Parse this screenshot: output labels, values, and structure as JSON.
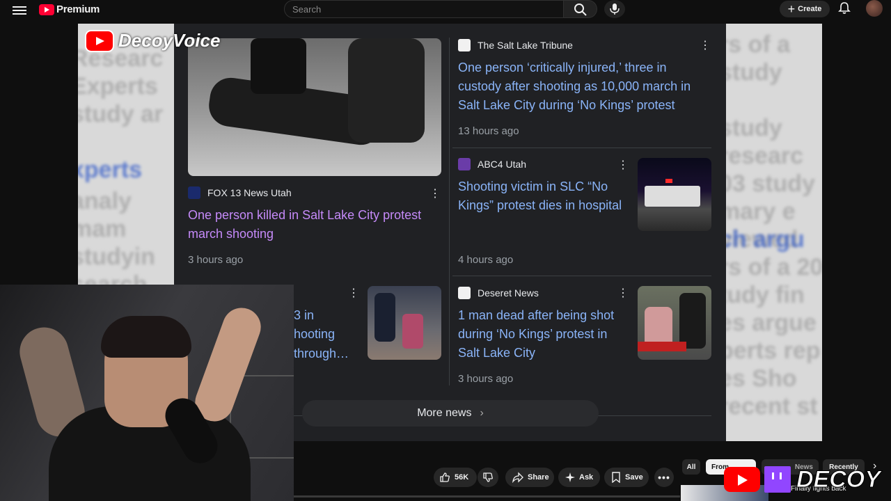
{
  "topbar": {
    "logo_text": "Premium",
    "search_placeholder": "Search",
    "create_label": "Create"
  },
  "video": {
    "channel_brand": "DecoyVoice",
    "news": {
      "articles": [
        {
          "source": "FOX 13 News Utah",
          "headline": "One person killed in Salt Lake City protest march shooting",
          "time": "3 hours ago"
        },
        {
          "source": "The Salt Lake Tribune",
          "headline": "One person ‘critically injured,’ three in custody after shooting as 10,000 march in Salt Lake City during ‘No Kings’ protest",
          "time": "13 hours ago"
        },
        {
          "source": "ABC4 Utah",
          "headline": "Shooting victim in SLC “No Kings” protest dies in hospital",
          "time": "4 hours ago"
        },
        {
          "source": "Deseret News",
          "headline": "1 man dead after being shot during ‘No Kings’ protest in Salt Lake City",
          "time": "3 hours ago"
        }
      ],
      "partial_headline_lines": [
        "3 in",
        "hooting",
        "through…"
      ],
      "more_news_label": "More news"
    }
  },
  "actions": {
    "like_count": "56K",
    "share_label": "Share",
    "ask_label": "Ask",
    "save_label": "Save"
  },
  "chips": {
    "all": "All",
    "from": "From",
    "news": "News",
    "recently": "Recently"
  },
  "overlay_brand": "DECOY",
  "recommendation_title": "Finally fights back",
  "colors": {
    "youtube_red": "#ff0033",
    "headline_blue": "#8ab4f8",
    "headline_visited": "#c58af9",
    "twitch_purple": "#9146ff"
  }
}
